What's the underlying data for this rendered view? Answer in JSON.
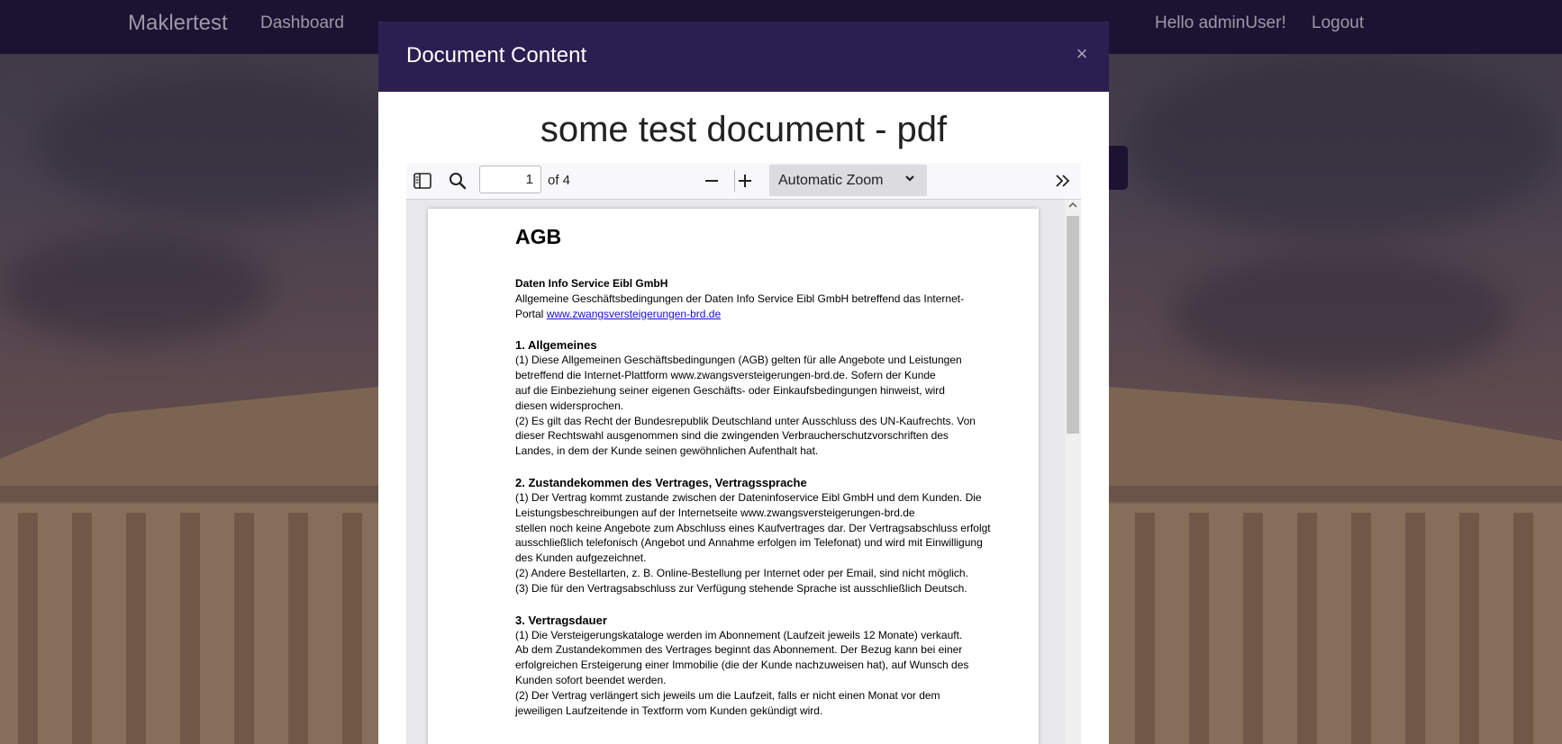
{
  "navbar": {
    "brand": "Maklertest",
    "dashboard": "Dashboard",
    "greeting": "Hello adminUser!",
    "logout": "Logout"
  },
  "modal": {
    "title": "Document Content",
    "close_icon": "×",
    "document_title": "some test document - pdf"
  },
  "viewer": {
    "page_number": "1",
    "page_of": "of 4",
    "zoom": "Automatic Zoom"
  },
  "pdf": {
    "heading": "AGB",
    "company": "Daten Info Service Eibl GmbH",
    "intro_1": "Allgemeine Geschäftsbedingungen der Daten Info Service Eibl GmbH betreffend das Internet-",
    "intro_2": "Portal ",
    "intro_link": "www.zwangsversteigerungen-brd.de",
    "s1_title": "1. Allgemeines",
    "s1_l1": "(1) Diese Allgemeinen Geschäftsbedingungen (AGB) gelten für alle Angebote und Leistungen",
    "s1_l2": "betreffend die Internet-Plattform www.zwangsversteigerungen-brd.de. Sofern der Kunde",
    "s1_l3": "auf die Einbeziehung seiner eigenen Geschäfts- oder Einkaufsbedingungen hinweist, wird",
    "s1_l4": "diesen widersprochen.",
    "s1_l5": " (2) Es gilt das Recht der Bundesrepublik Deutschland unter Ausschluss des UN-Kaufrechts. Von",
    "s1_l6": "dieser Rechtswahl ausgenommen sind die zwingenden Verbraucherschutzvorschriften des",
    "s1_l7": "Landes, in dem der Kunde seinen gewöhnlichen Aufenthalt hat.",
    "s2_title": "2. Zustandekommen des Vertrages, Vertragssprache",
    "s2_l1": "(1) Der Vertrag kommt zustande zwischen der Dateninfoservice Eibl GmbH und dem Kunden. Die",
    "s2_l2": "Leistungsbeschreibungen auf der Internetseite www.zwangsversteigerungen-brd.de",
    "s2_l3": "stellen noch keine Angebote zum Abschluss eines Kaufvertrages dar. Der Vertragsabschluss erfolgt",
    "s2_l4": "ausschließlich telefonisch (Angebot und Annahme erfolgen im Telefonat) und wird mit Einwilligung",
    "s2_l5": "des Kunden aufgezeichnet.",
    "s2_l6": "(2) Andere Bestellarten, z. B. Online-Bestellung per Internet oder per Email, sind nicht möglich.",
    "s2_l7": "(3) Die für den Vertragsabschluss zur Verfügung stehende Sprache ist ausschließlich Deutsch.",
    "s3_title": "3. Vertragsdauer",
    "s3_l1": "(1) Die Versteigerungskataloge werden im Abonnement (Laufzeit jeweils 12 Monate) verkauft.",
    "s3_l2": "Ab dem Zustandekommen des Vertrages beginnt das Abonnement. Der Bezug kann bei einer",
    "s3_l3": "erfolgreichen Ersteigerung einer Immobilie (die der Kunde nachzuweisen hat), auf Wunsch des",
    "s3_l4": "Kunden sofort beendet werden.",
    "s3_l5": "(2) Der Vertrag verlängert sich jeweils um die Laufzeit, falls er nicht einen Monat vor dem",
    "s3_l6": "jeweiligen Laufzeitende in Textform vom Kunden gekündigt wird."
  }
}
